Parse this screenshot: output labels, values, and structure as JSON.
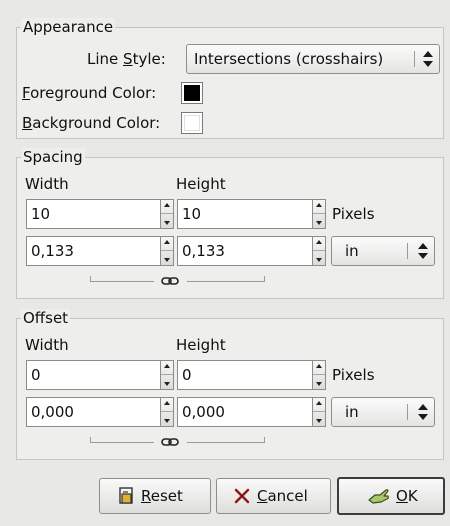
{
  "appearance": {
    "legend": "Appearance",
    "line_style_label_pre": "Line ",
    "line_style_label_u": "S",
    "line_style_label_post": "tyle:",
    "line_style_value": "Intersections (crosshairs)",
    "fg_label_u": "F",
    "fg_label_rest": "oreground Color:",
    "fg_color": "#000000",
    "bg_label_u": "B",
    "bg_label_rest": "ackground Color:",
    "bg_color": "#ffffff"
  },
  "spacing": {
    "legend": "Spacing",
    "width_label": "Width",
    "height_label": "Height",
    "width_px": "10",
    "height_px": "10",
    "px_unit": "Pixels",
    "width_in": "0,133",
    "height_in": "0,133",
    "unit": "in"
  },
  "offset": {
    "legend": "Offset",
    "width_label": "Width",
    "height_label": "Height",
    "width_px": "0",
    "height_px": "0",
    "px_unit": "Pixels",
    "width_in": "0,000",
    "height_in": "0,000",
    "unit": "in"
  },
  "buttons": {
    "reset_u": "R",
    "reset_rest": "eset",
    "cancel_u": "C",
    "cancel_rest": "ancel",
    "ok_u": "O",
    "ok_rest": "K"
  },
  "icons": {
    "reset": "reset-icon",
    "cancel": "cancel-x-icon",
    "ok": "ok-hand-icon",
    "chain": "chain-link-icon"
  }
}
